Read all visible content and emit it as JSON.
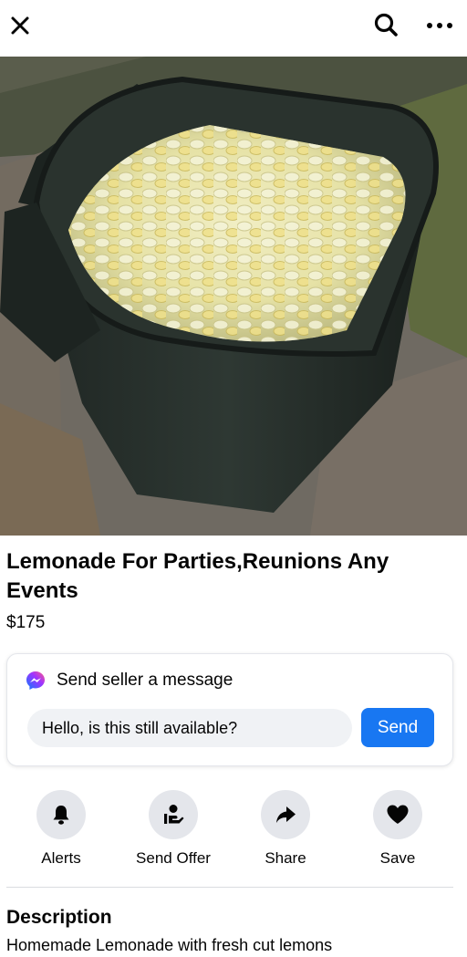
{
  "topbar": {
    "close_icon": "close-icon",
    "search_icon": "search-icon",
    "more_icon": "more-horizontal-icon"
  },
  "photo": {
    "subject": "green trash bin filled with lemonade and lemon slices"
  },
  "listing": {
    "title": "Lemonade For Parties,Reunions Any Events",
    "price": "$175"
  },
  "message": {
    "header_label": "Send seller a message",
    "input_value": "Hello, is this still available?",
    "send_label": "Send",
    "brand_color": "#1877f2"
  },
  "actions": [
    {
      "label": "Alerts",
      "icon": "bell-icon"
    },
    {
      "label": "Send Offer",
      "icon": "send-offer-icon"
    },
    {
      "label": "Share",
      "icon": "share-arrow-icon"
    },
    {
      "label": "Save",
      "icon": "heart-icon"
    }
  ],
  "description": {
    "heading": "Description",
    "text": "Homemade Lemonade with fresh cut lemons"
  }
}
